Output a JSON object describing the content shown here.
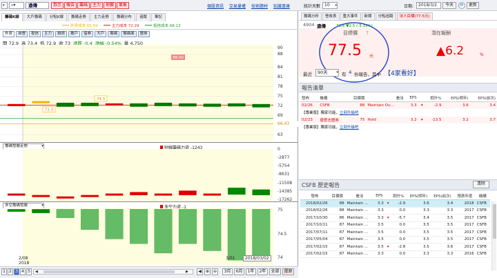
{
  "topbar": {
    "stock_name": "遠傳",
    "red_buttons": [
      "券示",
      "報告",
      "籌碼",
      "主力",
      "地籤",
      "氣象"
    ],
    "links": [
      "個股資訊",
      "交易量權",
      "技術題材",
      "知識書庫"
    ],
    "right_label_stats": "統計天數",
    "right_days": "10",
    "date_label": "日期:",
    "date_value": "2018/3/2",
    "today_btn": "今天",
    "refresh_btn": "更新"
  },
  "left": {
    "tabs": [
      "籌碼K線",
      "大戶籌碼",
      "分點K線",
      "籌碼走勢",
      "主力走勢",
      "籌碼分布",
      "追蹤",
      "筆記"
    ],
    "legend": [
      {
        "label": "外資成本 65.59",
        "color": "#f0b400"
      },
      {
        "label": "主力成本 72.29",
        "color": "#e02020"
      },
      {
        "label": "投信成本 68.13",
        "color": "#20a020"
      }
    ],
    "chips": [
      "外資",
      "自營",
      "投信",
      "主力",
      "融資",
      "散戶",
      "借券",
      "大戶",
      "籌碼",
      "籌碼面",
      "證券"
    ],
    "ohlc": {
      "open": "開 72.9",
      "high": "高 73.4",
      "low": "低 72.9",
      "close": "收 73",
      "chg": "漲跌 -0.4",
      "pct": "漲幅 -0.54%",
      "vol": "量 4,750"
    },
    "price_axis": [
      "90",
      "88",
      "84",
      "81",
      "78",
      "75",
      "72",
      "69",
      "66.43",
      "63"
    ],
    "price_tag_top": "88.00",
    "price_tag_mid": "74.3",
    "price_tag_low": "72.3",
    "panel2": {
      "select": "籌碼發展走勢",
      "label": "短線籌碼力道 -1243",
      "axis": [
        "0",
        "-2877",
        "-5754",
        "-8631",
        "-11508",
        "-14385",
        "-17262"
      ]
    },
    "panel3": {
      "select": "多空籌碼發展",
      "label": "多空力道 -1",
      "axis": [
        "75",
        "74.5",
        "74"
      ]
    },
    "x_labels": {
      "start": "2/08",
      "year": "2018",
      "mid": "3/01",
      "end": "2018/03/02"
    },
    "pages": [
      "1",
      "2",
      "3",
      "4",
      "5"
    ],
    "range_btns": [
      "3月",
      "6月",
      "1年",
      "2年",
      "全部",
      "還原"
    ],
    "candles": [
      {
        "o": 72.4,
        "c": 72.4,
        "h": 72.6,
        "l": 72.2,
        "up": false
      },
      {
        "o": 73.3,
        "c": 73.3,
        "h": 73.5,
        "l": 73.1,
        "up": false
      },
      {
        "o": 72.8,
        "c": 72.2,
        "h": 73.0,
        "l": 72.0,
        "up": false
      },
      {
        "o": 72.8,
        "c": 72.4,
        "h": 73.0,
        "l": 72.2,
        "up": false
      },
      {
        "o": 72.6,
        "c": 72.6,
        "h": 72.8,
        "l": 72.4,
        "up": true
      },
      {
        "o": 72.6,
        "c": 72.2,
        "h": 72.8,
        "l": 72.0,
        "up": false
      },
      {
        "o": 72.8,
        "c": 72.4,
        "h": 73.0,
        "l": 72.2,
        "up": false
      },
      {
        "o": 72.6,
        "c": 72.3,
        "h": 72.8,
        "l": 72.0,
        "up": false
      },
      {
        "o": 72.5,
        "c": 72.2,
        "h": 72.7,
        "l": 72.0,
        "up": false
      },
      {
        "o": 72.6,
        "c": 72.3,
        "h": 72.8,
        "l": 72.1,
        "up": false
      },
      {
        "o": 72.4,
        "c": 72.0,
        "h": 72.6,
        "l": 71.8,
        "up": false
      }
    ],
    "bars2": [
      {
        "v": -16000,
        "color": "#d00"
      },
      {
        "v": -16500,
        "color": "#d00"
      },
      {
        "v": -17000,
        "color": "#d00"
      },
      {
        "v": -16500,
        "color": "#d00"
      },
      {
        "v": -16000,
        "color": "#d00"
      },
      {
        "v": -15500,
        "color": "#d00"
      },
      {
        "v": -16000,
        "color": "#d00"
      },
      {
        "v": -15000,
        "color": "#d00"
      },
      {
        "v": -16000,
        "color": "#d00"
      },
      {
        "v": -14000,
        "color": "#080"
      },
      {
        "v": -14600,
        "color": "#080"
      }
    ],
    "bars3": [
      {
        "v": 74.98,
        "color": "#080"
      },
      {
        "v": 74.95,
        "color": "#080"
      },
      {
        "v": 74.85,
        "color": "#6b6"
      },
      {
        "v": 74.6,
        "color": "#6b6"
      },
      {
        "v": 74.4,
        "color": "#6b6"
      },
      {
        "v": 74.3,
        "color": "#6b6"
      },
      {
        "v": 74.1,
        "color": "#6b6"
      },
      {
        "v": 74.3,
        "color": "#6b6"
      },
      {
        "v": 74.15,
        "color": "#6b6"
      },
      {
        "v": 73.95,
        "color": "#6b6"
      },
      {
        "v": 74.0,
        "color": "#6b6"
      }
    ]
  },
  "right": {
    "tabs": [
      "籌碼分析",
      "營收表",
      "重大事件",
      "新聞",
      "分點追蹤",
      "法人目標(77.5元)"
    ],
    "stock_code": "4904",
    "stock_name": "遠傳",
    "price_line": "73元 ▼2.5 (-3.33%)",
    "target_label": "目標價",
    "target_help": "?",
    "target_value": "77.5",
    "target_unit": "元",
    "upside_label": "潛在報酬",
    "upside_value": "▲6.2",
    "upside_unit": "%",
    "recent_label": "最近",
    "recent_days": "90天",
    "has_label": "有",
    "report_count": "4",
    "report_text": "份報告，其中",
    "good_count": "【4家看好】",
    "report_section": "報告清單",
    "report_headers": [
      "發佈",
      "機構",
      "目標價",
      "看法",
      "EPS",
      "",
      "調升%",
      "EPS(明年)",
      "EPS(前次)"
    ],
    "reports": [
      {
        "date": "02/26",
        "inst": "CSFB",
        "target": "88",
        "view": "Maintain Ou...",
        "eps": "3.3",
        "arrow": "▾",
        "chg": "-2.9",
        "eps_next": "3.6",
        "eps_prev": "3.4"
      },
      {
        "date": "02/23",
        "inst": "德意志證券",
        "target": "75",
        "view": "Hold",
        "eps": "3.2",
        "arrow": "▾",
        "chg": "-13.5",
        "eps_next": "3.2",
        "eps_prev": "3.7"
      }
    ],
    "vip_note": "【專業版】獨家功能，",
    "vip_link": "立刻升級吧",
    "hist_title": "CSFB 歷史報告",
    "clear_btn": "清除",
    "hist_headers": [
      "發佈",
      "目標價",
      "看法",
      "EPS",
      "",
      "調升%",
      "EPS(明年)",
      "EPS(前次)",
      "預測年度",
      "機構"
    ],
    "history": [
      {
        "date": "2018/02/26",
        "target": "88",
        "view": "Maintain ...",
        "eps": "3.3",
        "arrow": "▾",
        "chg": "-2.9",
        "eps_next": "3.6",
        "eps_prev": "3.4",
        "year": "2018",
        "inst": "CSFB"
      },
      {
        "date": "2018/02/26",
        "target": "88",
        "view": "Maintain ...",
        "eps": "3.3",
        "arrow": "",
        "chg": "0.0",
        "eps_next": "3.3",
        "eps_prev": "3.3",
        "year": "2017",
        "inst": "CSFB"
      },
      {
        "date": "2017/10/30",
        "target": "86",
        "view": "Maintain ...",
        "eps": "3.3",
        "arrow": "▾",
        "chg": "-5.7",
        "eps_next": "3.4",
        "eps_prev": "3.5",
        "year": "2017",
        "inst": "CSFB"
      },
      {
        "date": "2017/10/11",
        "target": "87",
        "view": "Maintain ...",
        "eps": "3.5",
        "arrow": "",
        "chg": "0.0",
        "eps_next": "3.5",
        "eps_prev": "3.5",
        "year": "2017",
        "inst": "CSFB"
      },
      {
        "date": "2017/07/11",
        "target": "87",
        "view": "Maintain ...",
        "eps": "3.5",
        "arrow": "",
        "chg": "0.0",
        "eps_next": "3.5",
        "eps_prev": "3.5",
        "year": "2017",
        "inst": "CSFB"
      },
      {
        "date": "2017/05/04",
        "target": "87",
        "view": "Maintain ...",
        "eps": "3.5",
        "arrow": "",
        "chg": "0.0",
        "eps_next": "3.5",
        "eps_prev": "3.5",
        "year": "2017",
        "inst": "CSFB"
      },
      {
        "date": "2017/02/15",
        "target": "87",
        "view": "Maintain ...",
        "eps": "3.5",
        "arrow": "▾",
        "chg": "-2.8",
        "eps_next": "3.5",
        "eps_prev": "3.6",
        "year": "2017",
        "inst": "CSFB"
      },
      {
        "date": "2017/02/15",
        "target": "87",
        "view": "Maintain ...",
        "eps": "3.3",
        "arrow": "",
        "chg": "0.0",
        "eps_next": "3.3",
        "eps_prev": "3.3",
        "year": "2016",
        "inst": "CSFB"
      }
    ]
  }
}
